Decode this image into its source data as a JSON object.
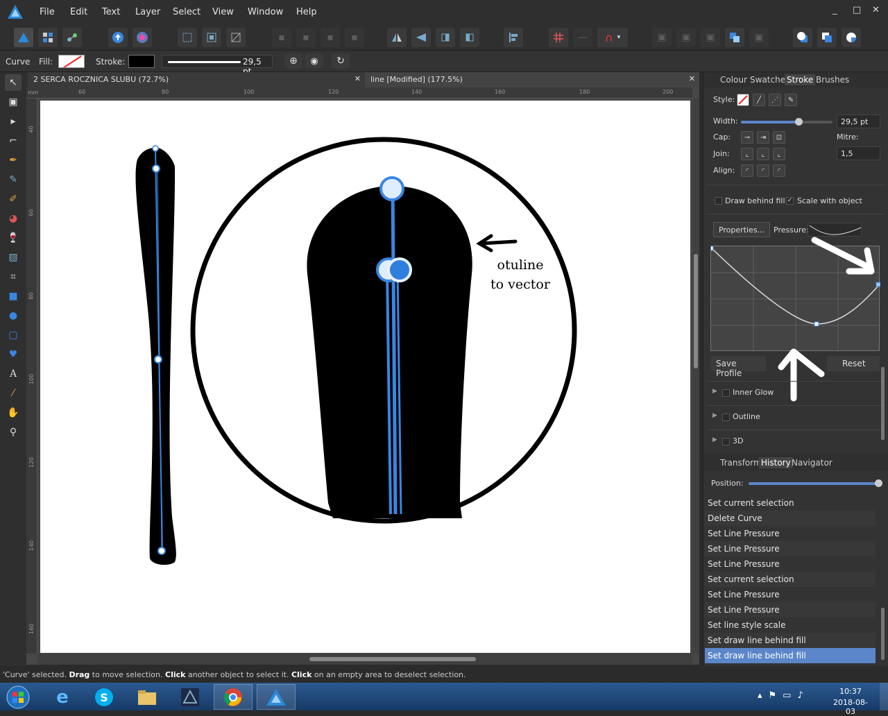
{
  "menu": [
    "File",
    "Edit",
    "Text",
    "Layer",
    "Select",
    "View",
    "Window",
    "Help"
  ],
  "window_controls": [
    "_",
    "□",
    "✕"
  ],
  "context": {
    "tool_name": "Curve",
    "fill_label": "Fill:",
    "stroke_label": "Stroke:",
    "stroke_width": "29,5 pt"
  },
  "doc_tabs": [
    {
      "title": "2 SERCA  ROCZNICA SLUBU (72.7%)",
      "close": "✕"
    },
    {
      "title": "line [Modified] (177.5%)",
      "close": "✕"
    }
  ],
  "ruler": {
    "unit": "mm",
    "h_ticks": [
      "60",
      "80",
      "100",
      "120",
      "140",
      "160",
      "180",
      "200"
    ],
    "v_ticks": [
      "40",
      "60",
      "80",
      "100",
      "120",
      "140",
      "160"
    ]
  },
  "annotation": {
    "line1": "otuline",
    "line2": "to vector"
  },
  "panel_top": {
    "tabs": [
      "Colour",
      "Swatches",
      "Stroke",
      "Brushes"
    ],
    "active_tab": "Stroke",
    "style_label": "Style:",
    "width_label": "Width:",
    "width_value": "29,5 pt",
    "width_fraction": 0.63,
    "cap_label": "Cap:",
    "mitre_label": "Mitre:",
    "join_label": "Join:",
    "mitre_value": "1,5",
    "align_label": "Align:",
    "draw_behind_fill": "Draw behind fill",
    "scale_with_object": "Scale with object",
    "properties_button": "Properties...",
    "pressure_label": "Pressure:",
    "save_profile": "Save Profile",
    "reset": "Reset",
    "effects": [
      "Inner Glow",
      "Outline",
      "3D"
    ]
  },
  "panel_bottom": {
    "tabs": [
      "Transform",
      "History",
      "Navigator"
    ],
    "active_tab": "History",
    "position_label": "Position:",
    "position_fraction": 1.0,
    "history": [
      "Set current selection",
      "Delete Curve",
      "Set Line Pressure",
      "Set Line Pressure",
      "Set Line Pressure",
      "Set current selection",
      "Set Line Pressure",
      "Set Line Pressure",
      "Set line style scale",
      "Set draw line behind fill",
      "Set draw line behind fill"
    ],
    "selected_index": 10
  },
  "status": {
    "p1": "'Curve' selected. ",
    "b1": "Drag",
    "p2": " to move selection. ",
    "b2": "Click",
    "p3": " another object to select it. ",
    "b3": "Click",
    "p4": " on an empty area to deselect selection."
  },
  "taskbar": {
    "time": "10:37",
    "date": "2018-08-03"
  },
  "colors": {
    "accent": "#5b86c9",
    "node": "#3a86e0",
    "canvas_bg": "#474747",
    "panel_bg": "#333333"
  }
}
